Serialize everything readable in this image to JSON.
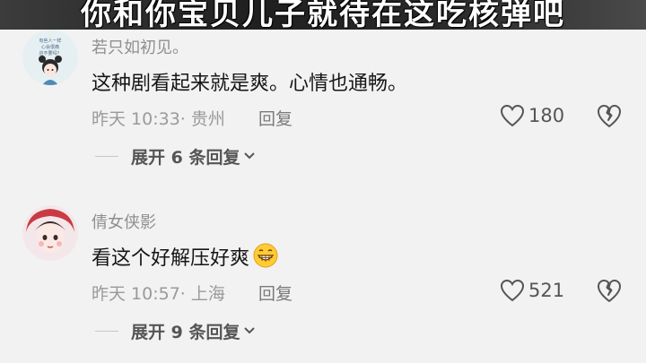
{
  "banner": {
    "text": "你和你宝贝儿子就待在这吃核弹吧"
  },
  "comments": [
    {
      "username": "若只如初见。",
      "avatar_text": [
        "有些人一样",
        "心会很痛",
        "应不要吗？"
      ],
      "content": "这种剧看起来就是爽。心情也通畅。",
      "time": "昨天 10:33",
      "location": "· 贵州",
      "reply_label": "回复",
      "likes": "180",
      "expand_label": "展开 6 条回复"
    },
    {
      "username": "倩女侠影",
      "content": "看这个好解压好爽",
      "emoji": "grinning-face-emoji",
      "time": "昨天 10:57",
      "location": "· 上海",
      "reply_label": "回复",
      "likes": "521",
      "expand_label": "展开 9 条回复"
    }
  ],
  "icons": {
    "like": "heart-outline-icon",
    "dislike": "broken-heart-icon",
    "expand": "chevron-down-icon"
  }
}
